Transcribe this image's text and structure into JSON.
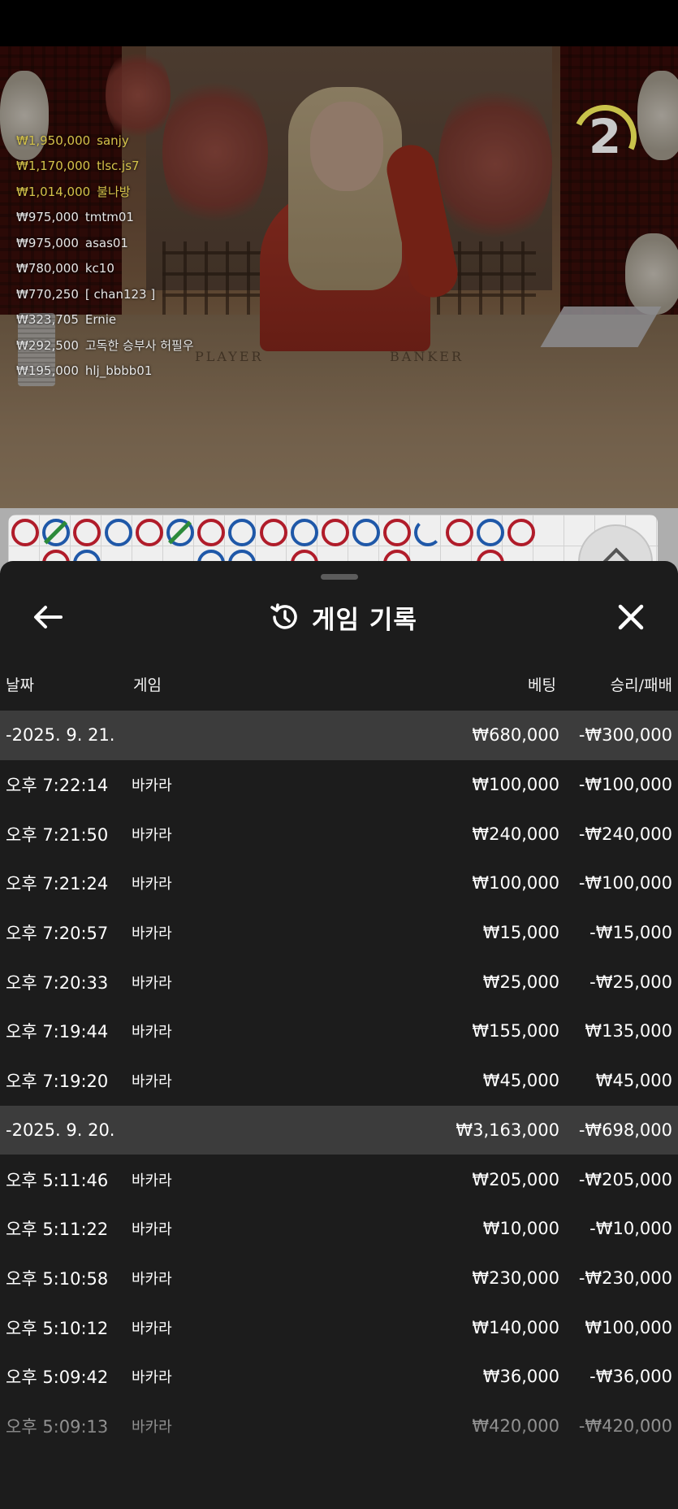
{
  "timer": {
    "value": "2"
  },
  "winners": [
    {
      "amount": "₩1,950,000",
      "name": "sanjy",
      "color": "#d4c24a"
    },
    {
      "amount": "₩1,170,000",
      "name": "tlsc.js7",
      "color": "#d4c24a"
    },
    {
      "amount": "₩1,014,000",
      "name": "불나방",
      "color": "#d4c24a"
    },
    {
      "amount": "₩975,000",
      "name": "tmtm01",
      "color": "#e6e6e6"
    },
    {
      "amount": "₩975,000",
      "name": "asas01",
      "color": "#e6e6e6"
    },
    {
      "amount": "₩780,000",
      "name": "kc10",
      "color": "#e6e6e6"
    },
    {
      "amount": "₩770,250",
      "name": "[ chan123 ]",
      "color": "#e6e6e6"
    },
    {
      "amount": "₩323,705",
      "name": "Ernie",
      "color": "#e6e6e6"
    },
    {
      "amount": "₩292,500",
      "name": "고독한 승부사 허필우",
      "color": "#e6e6e6"
    },
    {
      "amount": "₩195,000",
      "name": "hlj_bbbb01",
      "color": "#e6e6e6"
    }
  ],
  "table_labels": {
    "player": "PLAYER",
    "banker": "BANKER"
  },
  "road": {
    "row1": [
      "b",
      "p",
      "b",
      "p",
      "b",
      "p",
      "b",
      "p",
      "b",
      "p",
      "b",
      "p",
      "b",
      "p",
      "b",
      "p",
      "b"
    ],
    "row1_tie": [
      false,
      true,
      false,
      false,
      false,
      true,
      false,
      false,
      false,
      false,
      false,
      false,
      false,
      false,
      false,
      false,
      false
    ],
    "row1_partial": [
      false,
      false,
      false,
      false,
      false,
      false,
      false,
      false,
      false,
      false,
      false,
      false,
      false,
      true,
      false,
      false,
      false
    ],
    "row2": [
      "",
      "b",
      "p",
      "",
      "",
      "",
      "p",
      "p",
      "",
      "b",
      "",
      "",
      "b",
      "",
      "",
      "b"
    ]
  },
  "sheet": {
    "title": "게임 기록",
    "columns": {
      "date": "날짜",
      "game": "게임",
      "bet": "베팅",
      "result": "승리/패배"
    },
    "rows": [
      {
        "kind": "group",
        "date": "-2025. 9. 21.",
        "game": "",
        "bet": "₩680,000",
        "result": "-₩300,000"
      },
      {
        "kind": "item",
        "date": "오후 7:22:14",
        "game": "바카라",
        "bet": "₩100,000",
        "result": "-₩100,000"
      },
      {
        "kind": "item",
        "date": "오후 7:21:50",
        "game": "바카라",
        "bet": "₩240,000",
        "result": "-₩240,000"
      },
      {
        "kind": "item",
        "date": "오후 7:21:24",
        "game": "바카라",
        "bet": "₩100,000",
        "result": "-₩100,000"
      },
      {
        "kind": "item",
        "date": "오후 7:20:57",
        "game": "바카라",
        "bet": "₩15,000",
        "result": "-₩15,000"
      },
      {
        "kind": "item",
        "date": "오후 7:20:33",
        "game": "바카라",
        "bet": "₩25,000",
        "result": "-₩25,000"
      },
      {
        "kind": "item",
        "date": "오후 7:19:44",
        "game": "바카라",
        "bet": "₩155,000",
        "result": "₩135,000"
      },
      {
        "kind": "item",
        "date": "오후 7:19:20",
        "game": "바카라",
        "bet": "₩45,000",
        "result": "₩45,000"
      },
      {
        "kind": "group",
        "date": "-2025. 9. 20.",
        "game": "",
        "bet": "₩3,163,000",
        "result": "-₩698,000"
      },
      {
        "kind": "item",
        "date": "오후 5:11:46",
        "game": "바카라",
        "bet": "₩205,000",
        "result": "-₩205,000"
      },
      {
        "kind": "item",
        "date": "오후 5:11:22",
        "game": "바카라",
        "bet": "₩10,000",
        "result": "-₩10,000"
      },
      {
        "kind": "item",
        "date": "오후 5:10:58",
        "game": "바카라",
        "bet": "₩230,000",
        "result": "-₩230,000"
      },
      {
        "kind": "item",
        "date": "오후 5:10:12",
        "game": "바카라",
        "bet": "₩140,000",
        "result": "₩100,000"
      },
      {
        "kind": "item",
        "date": "오후 5:09:42",
        "game": "바카라",
        "bet": "₩36,000",
        "result": "-₩36,000"
      },
      {
        "kind": "item",
        "date": "오후 5:09:13",
        "game": "바카라",
        "bet": "₩420,000",
        "result": "-₩420,000",
        "faded": true
      }
    ]
  },
  "icons": {
    "back": "arrow-left-icon",
    "history": "history-icon",
    "close": "close-icon",
    "collapse": "chevron-up-icon"
  }
}
